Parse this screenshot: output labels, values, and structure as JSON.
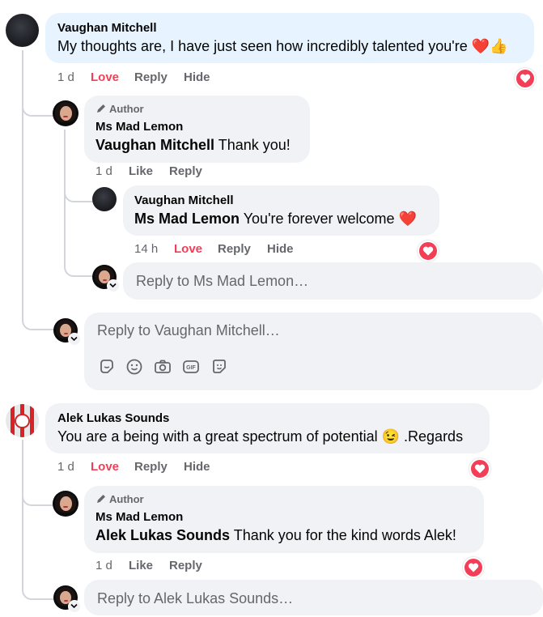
{
  "comments": [
    {
      "author": "Vaughan Mitchell",
      "text": "My thoughts are, I have just seen how incredibly talented you're",
      "emoji": "❤️👍",
      "time": "1 d",
      "love_label": "Love",
      "reply_label": "Reply",
      "hide_label": "Hide",
      "replies": [
        {
          "author_badge": "Author",
          "author": "Ms Mad Lemon",
          "mention": "Vaughan Mitchell",
          "text": " Thank you!",
          "time": "1 d",
          "like_label": "Like",
          "reply_label": "Reply"
        },
        {
          "author": "Vaughan Mitchell",
          "mention": "Ms Mad Lemon",
          "text": " You're forever welcome",
          "emoji": "❤️",
          "time": "14 h",
          "love_label": "Love",
          "reply_label": "Reply",
          "hide_label": "Hide"
        }
      ],
      "nested_reply_placeholder": "Reply to Ms Mad Lemon…",
      "reply_placeholder": "Reply to Vaughan Mitchell…"
    },
    {
      "author": "Alek Lukas Sounds",
      "text": "You are a being with a great spectrum of potential",
      "emoji": "😉",
      "text_after": " .Regards",
      "time": "1 d",
      "love_label": "Love",
      "reply_label": "Reply",
      "hide_label": "Hide",
      "replies": [
        {
          "author_badge": "Author",
          "author": "Ms Mad Lemon",
          "mention": "Alek Lukas Sounds",
          "text": " Thank you for the kind words Alek!",
          "time": "1 d",
          "like_label": "Like",
          "reply_label": "Reply"
        }
      ],
      "reply_placeholder": "Reply to Alek Lukas Sounds…"
    }
  ],
  "composer_tools": [
    "sticker-icon",
    "emoji-icon",
    "camera-icon",
    "gif-icon",
    "avatar-sticker-icon"
  ],
  "colors": {
    "love": "#f33e58",
    "bubble": "#f0f2f5",
    "highlight": "#e7f3ff",
    "meta": "#65676b"
  }
}
